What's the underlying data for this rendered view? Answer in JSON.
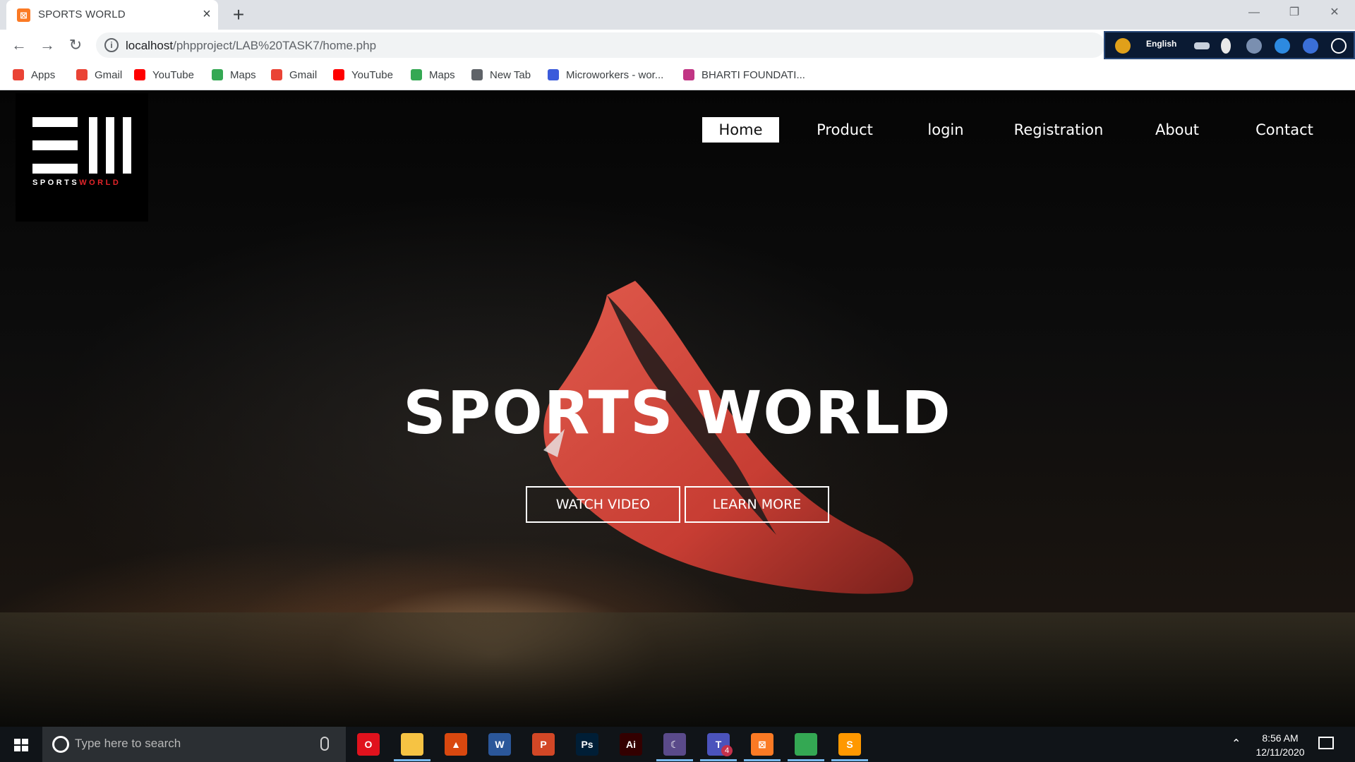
{
  "browser": {
    "tab_title": "SPORTS WORLD",
    "tab_close": "×",
    "new_tab": "+",
    "url_host": "localhost",
    "url_path": "/phpproject/LAB%20TASK7/home.php",
    "extension_lang": "English",
    "bookmarks": [
      {
        "label": "Apps",
        "icon": "apps-grid-icon",
        "color": "#ea4335"
      },
      {
        "label": "Gmail",
        "icon": "gmail-icon",
        "color": "#ea4335"
      },
      {
        "label": "YouTube",
        "icon": "youtube-icon",
        "color": "#ff0000"
      },
      {
        "label": "Maps",
        "icon": "maps-icon",
        "color": "#34a853"
      },
      {
        "label": "Gmail",
        "icon": "gmail-icon",
        "color": "#ea4335"
      },
      {
        "label": "YouTube",
        "icon": "youtube-icon",
        "color": "#ff0000"
      },
      {
        "label": "Maps",
        "icon": "maps-icon",
        "color": "#34a853"
      },
      {
        "label": "New Tab",
        "icon": "globe-icon",
        "color": "#5f6368"
      },
      {
        "label": "Microworkers - wor...",
        "icon": "microworkers-icon",
        "color": "#3b5bdb"
      },
      {
        "label": "BHARTI FOUNDATI...",
        "icon": "instagram-icon",
        "color": "#c13584"
      }
    ]
  },
  "site": {
    "logo_word_1": "SPORTS",
    "logo_word_2": "WORLD",
    "nav": [
      "Home",
      "Product",
      "login",
      "Registration",
      "About",
      "Contact"
    ],
    "active_nav": "Home",
    "hero_title": "SPORTS WORLD",
    "watch_video": "WATCH VIDEO",
    "learn_more": "LEARN MORE"
  },
  "taskbar": {
    "search_placeholder": "Type here to search",
    "time": "8:56 AM",
    "date": "12/11/2020",
    "teams_badge": "4",
    "apps": [
      {
        "name": "opera-icon",
        "label": "O",
        "color": "#e0121d"
      },
      {
        "name": "file-explorer-icon",
        "label": "",
        "color": "#f6c343"
      },
      {
        "name": "matlab-icon",
        "label": "▲",
        "color": "#d9480f"
      },
      {
        "name": "word-icon",
        "label": "W",
        "color": "#2b579a"
      },
      {
        "name": "powerpoint-icon",
        "label": "P",
        "color": "#d24726"
      },
      {
        "name": "photoshop-icon",
        "label": "Ps",
        "color": "#001e36"
      },
      {
        "name": "illustrator-icon",
        "label": "Ai",
        "color": "#330000"
      },
      {
        "name": "eclipse-icon",
        "label": "☾",
        "color": "#5a4a8a"
      },
      {
        "name": "teams-icon",
        "label": "T",
        "color": "#4b53bc"
      },
      {
        "name": "xampp-icon",
        "label": "⊠",
        "color": "#fb7a24"
      },
      {
        "name": "chrome-icon",
        "label": "",
        "color": "#34a853"
      },
      {
        "name": "sublime-icon",
        "label": "S",
        "color": "#ff9800"
      }
    ]
  },
  "colors": {
    "logo_accent": "#e5252a",
    "boot_red": "#d8473d"
  }
}
